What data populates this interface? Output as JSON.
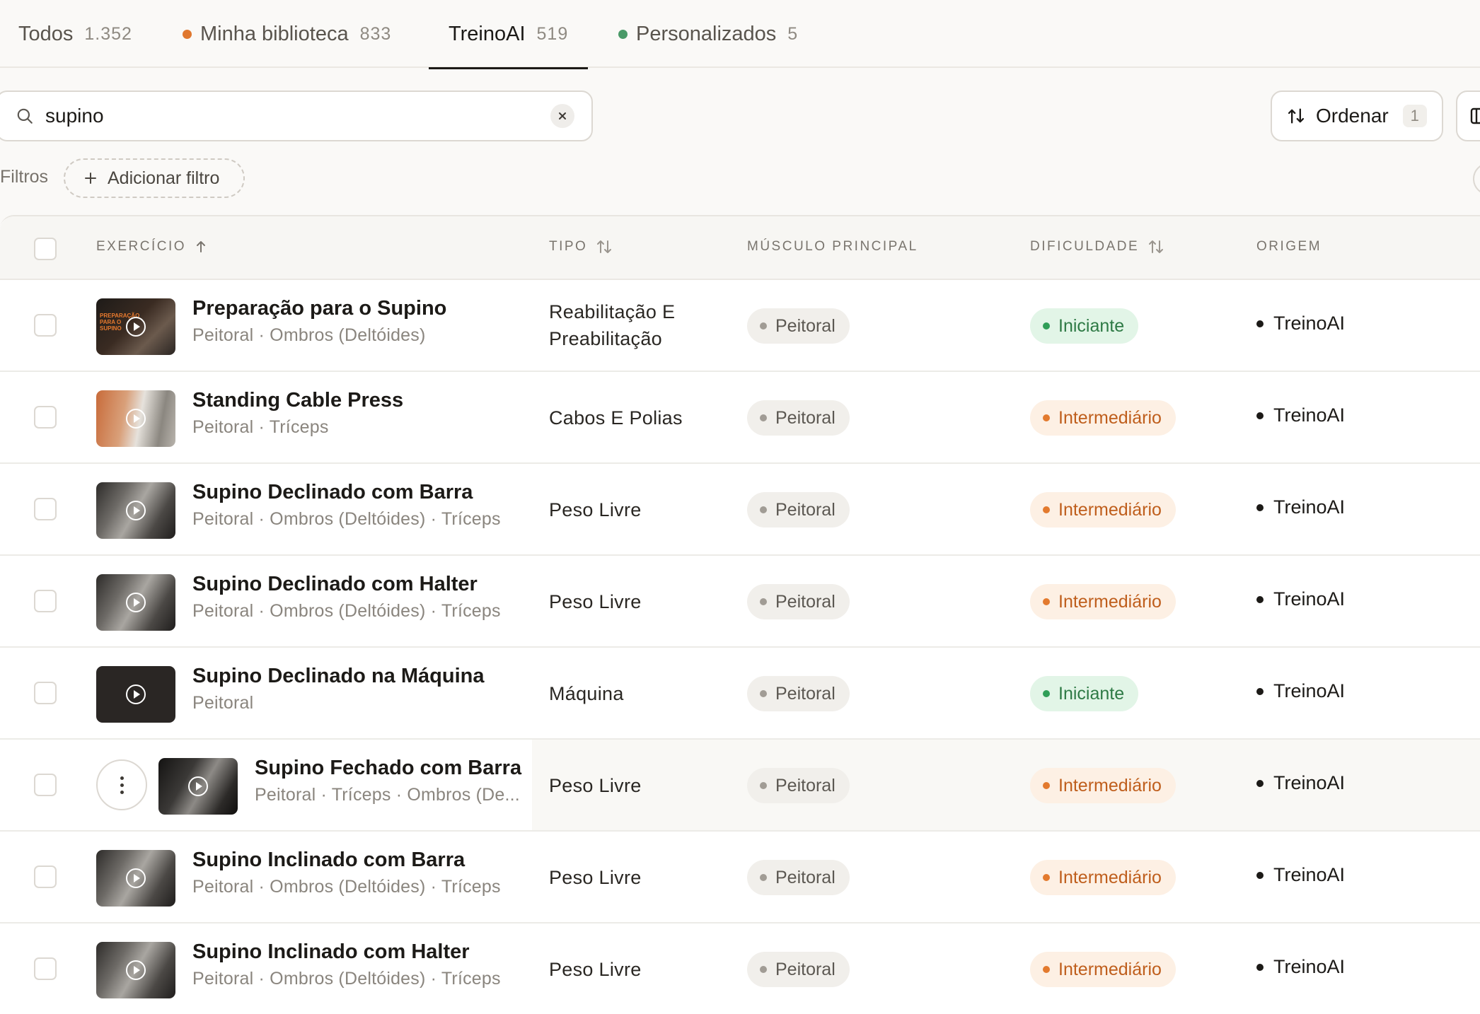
{
  "tabs": [
    {
      "label": "Todos",
      "count": "1.352",
      "dot": ""
    },
    {
      "label": "Minha biblioteca",
      "count": "833",
      "dot": "#e0782f"
    },
    {
      "label": "TreinoAI",
      "count": "519",
      "dot": ""
    },
    {
      "label": "Personalizados",
      "count": "5",
      "dot": "#4a9a68"
    }
  ],
  "active_tab": "TreinoAI",
  "search": {
    "value": "supino",
    "placeholder": ""
  },
  "toolbar": {
    "sort_label": "Ordenar",
    "sort_count": "1"
  },
  "filters": {
    "label": "Filtros",
    "add_label": "Adicionar filtro"
  },
  "columns": {
    "exercise": "EXERCÍCIO",
    "type": "TIPO",
    "muscle": "MÚSCULO PRINCIPAL",
    "difficulty": "DIFICULDADE",
    "origin": "ORIGEM"
  },
  "rows": [
    {
      "name": "Preparação para o Supino",
      "sub": "Peitoral · Ombros (Deltóides)",
      "type": "Reabilitação E Preabilitação",
      "muscle": "Peitoral",
      "difficulty": "Iniciante",
      "level": "beginner",
      "origin": "TreinoAI",
      "thumb": "prep"
    },
    {
      "name": "Standing Cable Press",
      "sub": "Peitoral · Tríceps",
      "type": "Cabos E Polias",
      "muscle": "Peitoral",
      "difficulty": "Intermediário",
      "level": "intermediate",
      "origin": "TreinoAI",
      "thumb": "gym-bright"
    },
    {
      "name": "Supino Declinado com Barra",
      "sub": "Peitoral · Ombros (Deltóides) · Tríceps",
      "type": "Peso Livre",
      "muscle": "Peitoral",
      "difficulty": "Intermediário",
      "level": "intermediate",
      "origin": "TreinoAI",
      "thumb": "gym"
    },
    {
      "name": "Supino Declinado com Halter",
      "sub": "Peitoral · Ombros (Deltóides) · Tríceps",
      "type": "Peso Livre",
      "muscle": "Peitoral",
      "difficulty": "Intermediário",
      "level": "intermediate",
      "origin": "TreinoAI",
      "thumb": "gym"
    },
    {
      "name": "Supino Declinado na Máquina",
      "sub": "Peitoral",
      "type": "Máquina",
      "muscle": "Peitoral",
      "difficulty": "Iniciante",
      "level": "beginner",
      "origin": "TreinoAI",
      "thumb": "dark"
    },
    {
      "name": "Supino Fechado com Barra",
      "sub": "Peitoral · Tríceps · Ombros (De...",
      "type": "Peso Livre",
      "muscle": "Peitoral",
      "difficulty": "Intermediário",
      "level": "intermediate",
      "origin": "TreinoAI",
      "thumb": "gym-dark"
    },
    {
      "name": "Supino Inclinado com Barra",
      "sub": "Peitoral · Ombros (Deltóides) · Tríceps",
      "type": "Peso Livre",
      "muscle": "Peitoral",
      "difficulty": "Intermediário",
      "level": "intermediate",
      "origin": "TreinoAI",
      "thumb": "gym"
    },
    {
      "name": "Supino Inclinado com Halter",
      "sub": "Peitoral · Ombros (Deltóides) · Tríceps",
      "type": "Peso Livre",
      "muscle": "Peitoral",
      "difficulty": "Intermediário",
      "level": "intermediate",
      "origin": "TreinoAI",
      "thumb": "gym"
    }
  ],
  "hovered_row": 5,
  "icons": {
    "search": "search-icon",
    "clear": "close-icon",
    "sort": "sort-arrows-icon",
    "columns": "columns-icon",
    "add": "plus-icon",
    "play": "play-icon",
    "menu": "more-vertical-icon"
  },
  "thumb_text": "PREPARAÇÃO PARA O SUPINO"
}
